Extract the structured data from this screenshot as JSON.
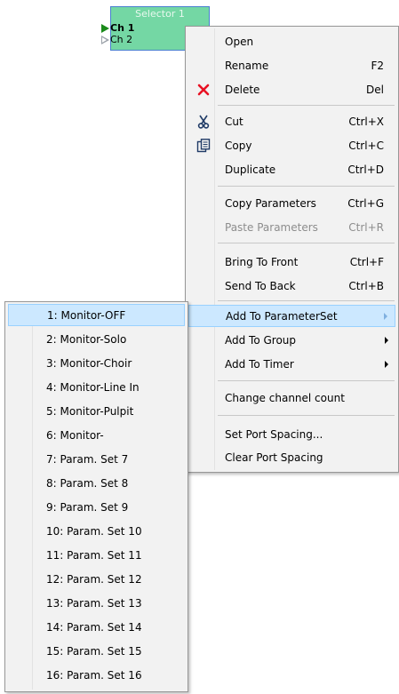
{
  "block": {
    "title": "Selector 1",
    "ports": [
      "Ch 1",
      "Ch 2"
    ]
  },
  "context_menu": {
    "items": [
      {
        "label": "Open",
        "shortcut": ""
      },
      {
        "label": "Rename",
        "shortcut": "F2"
      },
      {
        "label": "Delete",
        "shortcut": "Del",
        "icon": "delete-x-icon"
      },
      {
        "label": "Cut",
        "shortcut": "Ctrl+X",
        "icon": "scissors-icon"
      },
      {
        "label": "Copy",
        "shortcut": "Ctrl+C",
        "icon": "copy-icon"
      },
      {
        "label": "Duplicate",
        "shortcut": "Ctrl+D"
      },
      {
        "label": "Copy Parameters",
        "shortcut": "Ctrl+G"
      },
      {
        "label": "Paste Parameters",
        "shortcut": "Ctrl+R",
        "disabled": true
      },
      {
        "label": "Bring To Front",
        "shortcut": "Ctrl+F"
      },
      {
        "label": "Send To Back",
        "shortcut": "Ctrl+B"
      },
      {
        "label": "Add To ParameterSet",
        "submenu": true,
        "highlighted": true
      },
      {
        "label": "Add To Group",
        "submenu": true
      },
      {
        "label": "Add To Timer",
        "submenu": true
      },
      {
        "label": "Change channel count"
      },
      {
        "label": "Set Port Spacing..."
      },
      {
        "label": "Clear Port Spacing"
      }
    ]
  },
  "submenu": {
    "items": [
      "1: Monitor-OFF",
      "2: Monitor-Solo",
      "3: Monitor-Choir",
      "4: Monitor-Line In",
      "5: Monitor-Pulpit",
      "6: Monitor-",
      "7: Param. Set 7",
      "8: Param. Set 8",
      "9: Param. Set 9",
      "10: Param. Set 10",
      "11: Param. Set 11",
      "12: Param. Set 12",
      "13: Param. Set 13",
      "14: Param. Set 14",
      "15: Param. Set 15",
      "16: Param. Set 16"
    ],
    "highlighted_index": 0
  },
  "colors": {
    "block_fill": "#74d7a4",
    "block_border": "#4a7fd0",
    "highlight": "#cce8ff",
    "delete_red": "#e81123",
    "icon_navy": "#1f3a66"
  }
}
